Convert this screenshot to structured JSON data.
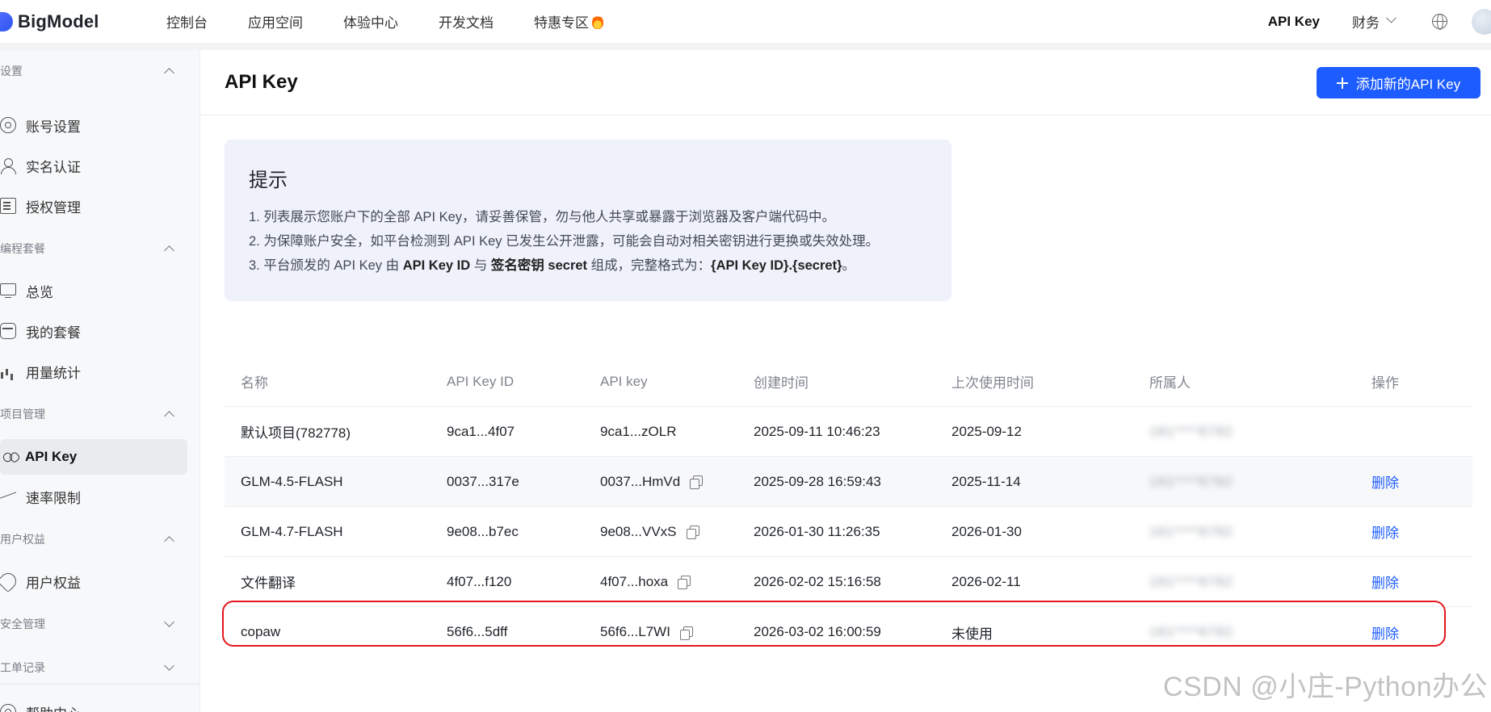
{
  "brand": {
    "name": "BigModel"
  },
  "topnav": [
    "控制台",
    "应用空间",
    "体验中心",
    "开发文档",
    "特惠专区"
  ],
  "topright": {
    "api_key": "API Key",
    "finance": "财务"
  },
  "sidebar": {
    "groups": [
      {
        "label": "设置"
      },
      {
        "label": "编程套餐"
      },
      {
        "label": "项目管理"
      },
      {
        "label": "用户权益"
      },
      {
        "label": "安全管理"
      },
      {
        "label": "工单记录"
      }
    ],
    "items": [
      {
        "label": "账号设置",
        "icon": "settings-icon"
      },
      {
        "label": "实名认证",
        "icon": "user-icon"
      },
      {
        "label": "授权管理",
        "icon": "authorization-icon"
      },
      {
        "label": "总览",
        "icon": "monitor-icon"
      },
      {
        "label": "我的套餐",
        "icon": "package-icon"
      },
      {
        "label": "用量统计",
        "icon": "chart-icon"
      },
      {
        "label": "API Key",
        "icon": "link-icon"
      },
      {
        "label": "速率限制",
        "icon": "trend-icon"
      },
      {
        "label": "用户权益",
        "icon": "badge-icon"
      }
    ],
    "footer_label": "帮助中心"
  },
  "page": {
    "title": "API Key",
    "add_button": "添加新的API Key"
  },
  "notice": {
    "title": "提示",
    "line1": "1. 列表展示您账户下的全部 API Key，请妥善保管，勿与他人共享或暴露于浏览器及客户端代码中。",
    "line2": "2. 为保障账户安全，如平台检测到 API Key 已发生公开泄露，可能会自动对相关密钥进行更换或失效处理。",
    "line3_a": "3. 平台颁发的 API Key 由 ",
    "line3_b": "API Key ID",
    "line3_c": " 与 ",
    "line3_d": "签名密钥 secret",
    "line3_e": " 组成，完整格式为：",
    "line3_f": "{API Key ID}.{secret}",
    "line3_g": "。"
  },
  "table": {
    "columns": [
      "名称",
      "API Key ID",
      "API key",
      "创建时间",
      "上次使用时间",
      "所属人",
      "操作"
    ],
    "rows": [
      {
        "name": "默认项目(782778)",
        "key_id": "9ca1...4f07",
        "api_key": "9ca1...zOLR",
        "created": "2025-09-11 10:46:23",
        "last_used": "2025-09-12",
        "owner": "181****6782",
        "action": ""
      },
      {
        "name": "GLM-4.5-FLASH",
        "key_id": "0037...317e",
        "api_key": "0037...HmVd",
        "created": "2025-09-28 16:59:43",
        "last_used": "2025-11-14",
        "owner": "181****6782",
        "action": "删除"
      },
      {
        "name": "GLM-4.7-FLASH",
        "key_id": "9e08...b7ec",
        "api_key": "9e08...VVxS",
        "created": "2026-01-30 11:26:35",
        "last_used": "2026-01-30",
        "owner": "181****6782",
        "action": "删除"
      },
      {
        "name": "文件翻译",
        "key_id": "4f07...f120",
        "api_key": "4f07...hoxa",
        "created": "2026-02-02 15:16:58",
        "last_used": "2026-02-11",
        "owner": "181****6782",
        "action": "删除"
      },
      {
        "name": "copaw",
        "key_id": "56f6...5dff",
        "api_key": "56f6...L7WI",
        "created": "2026-03-02 16:00:59",
        "last_used": "未使用",
        "owner": "181****6782",
        "action": "删除"
      }
    ]
  },
  "watermark": "CSDN @小庄-Python办公",
  "colors": {
    "primary": "#1d5cff",
    "highlight": "#e3171c",
    "notice_bg": "#eff1fb"
  }
}
